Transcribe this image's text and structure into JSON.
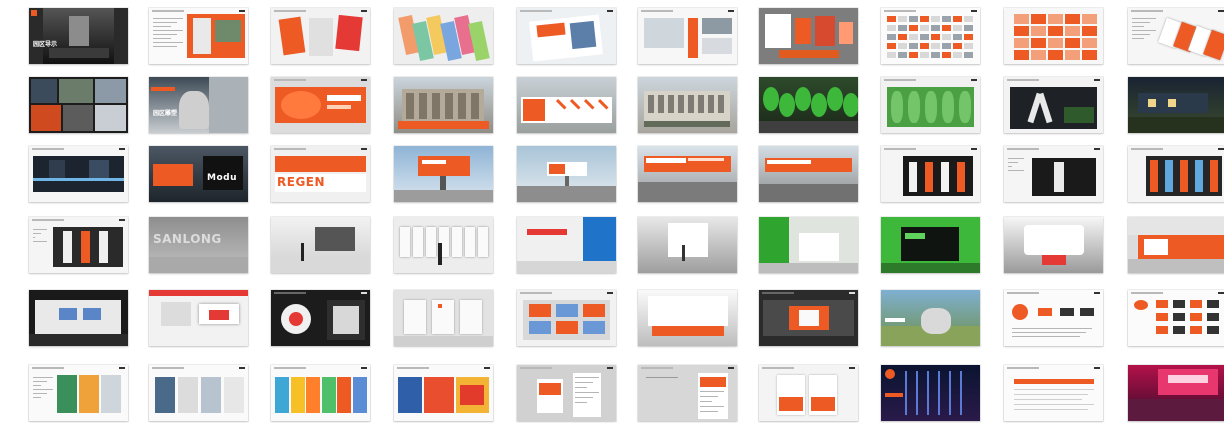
{
  "colors": {
    "orange": "#ee5a24",
    "red": "#e53935",
    "green": "#3db83a",
    "blue": "#1f73c9",
    "dark": "#1c1c1c",
    "gray": "#9a9a9a",
    "light": "#ececec"
  },
  "rows": [
    [
      {
        "theme": "atrium-dark",
        "title": "园区导示"
      },
      {
        "theme": "doc-orange",
        "title": ""
      },
      {
        "theme": "brochure-01-02",
        "title": ""
      },
      {
        "theme": "cards-colorful",
        "title": ""
      },
      {
        "theme": "folded-leaflet",
        "title": ""
      },
      {
        "theme": "web-layout",
        "title": ""
      },
      {
        "theme": "stationery-set",
        "title": ""
      },
      {
        "theme": "ui-grid",
        "title": ""
      },
      {
        "theme": "pattern-orange",
        "title": ""
      },
      {
        "theme": "doc-samples",
        "title": ""
      }
    ],
    [
      {
        "theme": "photo-collage",
        "title": ""
      },
      {
        "theme": "gorilla-statue",
        "title": "园区雕塑"
      },
      {
        "theme": "orange-hoarding",
        "title": ""
      },
      {
        "theme": "construction",
        "title": ""
      },
      {
        "theme": "hoarding-zigzag",
        "title": ""
      },
      {
        "theme": "gate-building",
        "title": ""
      },
      {
        "theme": "green-trees",
        "title": ""
      },
      {
        "theme": "green-wall",
        "title": ""
      },
      {
        "theme": "dark-logo",
        "title": ""
      },
      {
        "theme": "night-street",
        "title": ""
      }
    ],
    [
      {
        "theme": "dark-street",
        "title": ""
      },
      {
        "theme": "truck-sign",
        "title": "Modu"
      },
      {
        "theme": "regenerate-banner",
        "title": "REGEN"
      },
      {
        "theme": "billboard-high",
        "title": ""
      },
      {
        "theme": "billboard-road",
        "title": ""
      },
      {
        "theme": "highway-banner",
        "title": ""
      },
      {
        "theme": "highway-banner-2",
        "title": ""
      },
      {
        "theme": "pillar-signs",
        "title": ""
      },
      {
        "theme": "pillar-signs-2",
        "title": ""
      },
      {
        "theme": "pillar-signs-3",
        "title": ""
      }
    ],
    [
      {
        "theme": "pillar-signs-4",
        "title": ""
      },
      {
        "theme": "sanlong-gray",
        "title": "SANLONG"
      },
      {
        "theme": "gallery-white",
        "title": ""
      },
      {
        "theme": "wall-panels",
        "title": ""
      },
      {
        "theme": "exhibition-blue",
        "title": ""
      },
      {
        "theme": "corridor-white",
        "title": ""
      },
      {
        "theme": "room-green",
        "title": ""
      },
      {
        "theme": "green-room-2",
        "title": ""
      },
      {
        "theme": "tunnel-white",
        "title": ""
      },
      {
        "theme": "orange-wall",
        "title": ""
      }
    ],
    [
      {
        "theme": "dark-wall-screens",
        "title": ""
      },
      {
        "theme": "white-room-red",
        "title": ""
      },
      {
        "theme": "dark-exhibits",
        "title": ""
      },
      {
        "theme": "lab-white",
        "title": ""
      },
      {
        "theme": "screens-wall",
        "title": ""
      },
      {
        "theme": "lounge-white",
        "title": ""
      },
      {
        "theme": "corridor-dark",
        "title": ""
      },
      {
        "theme": "garden-sculpture",
        "title": ""
      },
      {
        "theme": "logo-doc",
        "title": ""
      },
      {
        "theme": "logo-grid",
        "title": ""
      }
    ],
    [
      {
        "theme": "magazine-covers",
        "title": ""
      },
      {
        "theme": "posters-vertical",
        "title": ""
      },
      {
        "theme": "posters-colorful",
        "title": ""
      },
      {
        "theme": "posters-red",
        "title": ""
      },
      {
        "theme": "web-page-gray",
        "title": ""
      },
      {
        "theme": "web-page-gray-2",
        "title": ""
      },
      {
        "theme": "booklet-white",
        "title": ""
      },
      {
        "theme": "night-event",
        "title": ""
      },
      {
        "theme": "doc-table",
        "title": ""
      },
      {
        "theme": "concert-crowd",
        "title": ""
      }
    ]
  ]
}
